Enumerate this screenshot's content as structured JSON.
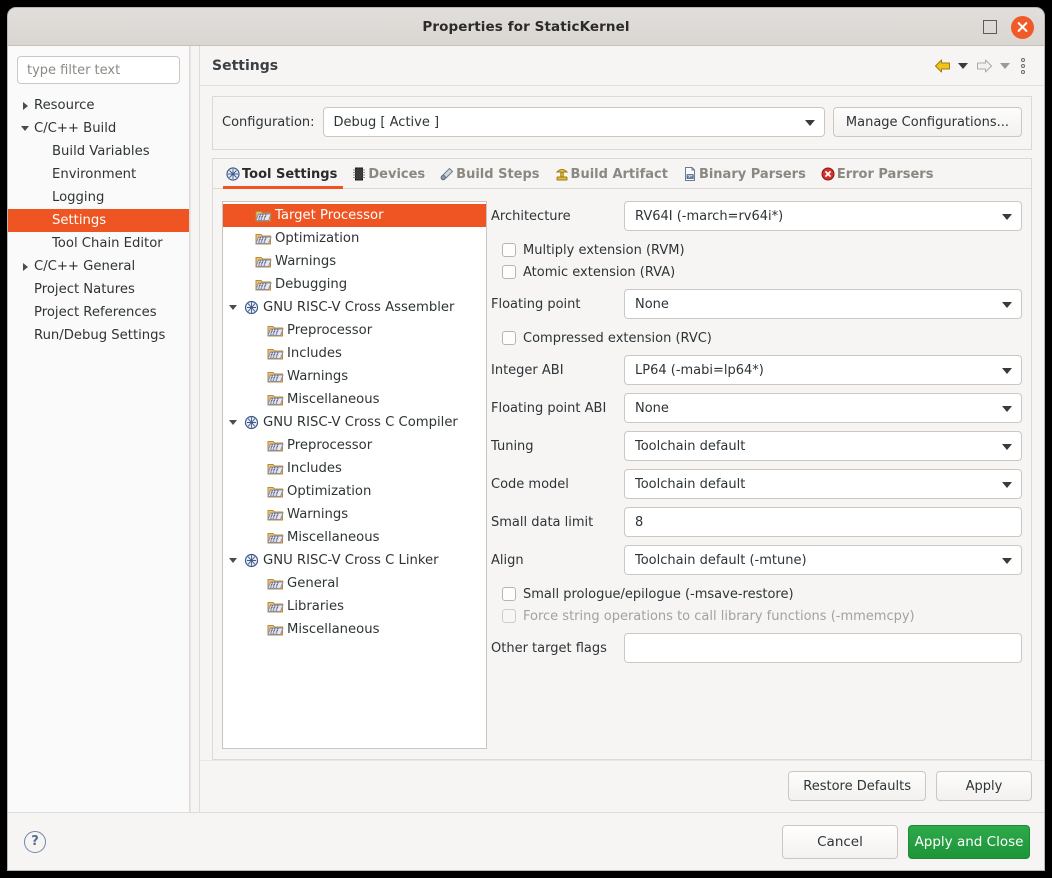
{
  "window": {
    "title": "Properties for StaticKernel",
    "maximize_icon": "maximize-icon",
    "close_icon": "close-icon"
  },
  "sidebar": {
    "filter_placeholder": "type filter text",
    "items": [
      {
        "label": "Resource",
        "indent": 0,
        "arrow": "collapsed",
        "selected": false
      },
      {
        "label": "C/C++ Build",
        "indent": 0,
        "arrow": "expanded",
        "selected": false
      },
      {
        "label": "Build Variables",
        "indent": 1,
        "arrow": "none",
        "selected": false
      },
      {
        "label": "Environment",
        "indent": 1,
        "arrow": "none",
        "selected": false
      },
      {
        "label": "Logging",
        "indent": 1,
        "arrow": "none",
        "selected": false
      },
      {
        "label": "Settings",
        "indent": 1,
        "arrow": "none",
        "selected": true
      },
      {
        "label": "Tool Chain Editor",
        "indent": 1,
        "arrow": "none",
        "selected": false
      },
      {
        "label": "C/C++ General",
        "indent": 0,
        "arrow": "collapsed",
        "selected": false
      },
      {
        "label": "Project Natures",
        "indent": 0,
        "arrow": "none",
        "selected": false
      },
      {
        "label": "Project References",
        "indent": 0,
        "arrow": "none",
        "selected": false
      },
      {
        "label": "Run/Debug Settings",
        "indent": 0,
        "arrow": "none",
        "selected": false
      }
    ]
  },
  "header": {
    "title": "Settings",
    "back_icon": "back-arrow-icon",
    "back_menu_icon": "chevron-down-icon",
    "forward_icon": "forward-arrow-icon",
    "forward_menu_icon": "chevron-down-icon",
    "menu_icon": "kebab-menu-icon"
  },
  "configuration": {
    "label": "Configuration:",
    "value": "Debug  [ Active ]",
    "manage_button": "Manage Configurations..."
  },
  "tabs": [
    {
      "label": "Tool Settings",
      "icon": "tool-settings-icon",
      "active": true
    },
    {
      "label": "Devices",
      "icon": "devices-icon",
      "active": false
    },
    {
      "label": "Build Steps",
      "icon": "build-steps-icon",
      "active": false
    },
    {
      "label": "Build Artifact",
      "icon": "build-artifact-icon",
      "active": false
    },
    {
      "label": "Binary Parsers",
      "icon": "binary-parsers-icon",
      "active": false
    },
    {
      "label": "Error Parsers",
      "icon": "error-parsers-icon",
      "active": false
    }
  ],
  "options_tree": [
    {
      "label": "Target Processor",
      "indent": 1,
      "arrow": "none",
      "icon": "folder-icon",
      "selected": true
    },
    {
      "label": "Optimization",
      "indent": 1,
      "arrow": "none",
      "icon": "folder-icon",
      "selected": false
    },
    {
      "label": "Warnings",
      "indent": 1,
      "arrow": "none",
      "icon": "folder-icon",
      "selected": false
    },
    {
      "label": "Debugging",
      "indent": 1,
      "arrow": "none",
      "icon": "folder-icon",
      "selected": false
    },
    {
      "label": "GNU RISC-V Cross Assembler",
      "indent": 0,
      "arrow": "expanded",
      "icon": "tool-icon",
      "selected": false
    },
    {
      "label": "Preprocessor",
      "indent": 2,
      "arrow": "none",
      "icon": "folder-icon",
      "selected": false
    },
    {
      "label": "Includes",
      "indent": 2,
      "arrow": "none",
      "icon": "folder-icon",
      "selected": false
    },
    {
      "label": "Warnings",
      "indent": 2,
      "arrow": "none",
      "icon": "folder-icon",
      "selected": false
    },
    {
      "label": "Miscellaneous",
      "indent": 2,
      "arrow": "none",
      "icon": "folder-icon",
      "selected": false
    },
    {
      "label": "GNU RISC-V Cross C Compiler",
      "indent": 0,
      "arrow": "expanded",
      "icon": "tool-icon",
      "selected": false
    },
    {
      "label": "Preprocessor",
      "indent": 2,
      "arrow": "none",
      "icon": "folder-icon",
      "selected": false
    },
    {
      "label": "Includes",
      "indent": 2,
      "arrow": "none",
      "icon": "folder-icon",
      "selected": false
    },
    {
      "label": "Optimization",
      "indent": 2,
      "arrow": "none",
      "icon": "folder-icon",
      "selected": false
    },
    {
      "label": "Warnings",
      "indent": 2,
      "arrow": "none",
      "icon": "folder-icon",
      "selected": false
    },
    {
      "label": "Miscellaneous",
      "indent": 2,
      "arrow": "none",
      "icon": "folder-icon",
      "selected": false
    },
    {
      "label": "GNU RISC-V Cross C Linker",
      "indent": 0,
      "arrow": "expanded",
      "icon": "tool-icon",
      "selected": false
    },
    {
      "label": "General",
      "indent": 2,
      "arrow": "none",
      "icon": "folder-icon",
      "selected": false
    },
    {
      "label": "Libraries",
      "indent": 2,
      "arrow": "none",
      "icon": "folder-icon",
      "selected": false
    },
    {
      "label": "Miscellaneous",
      "indent": 2,
      "arrow": "none",
      "icon": "folder-icon",
      "selected": false
    }
  ],
  "form": {
    "architecture": {
      "label": "Architecture",
      "value": "RV64I (-march=rv64i*)",
      "type": "combo"
    },
    "multiply_ext": {
      "label": "Multiply extension (RVM)",
      "checked": false,
      "enabled": true
    },
    "atomic_ext": {
      "label": "Atomic extension (RVA)",
      "checked": false,
      "enabled": true
    },
    "floating_point": {
      "label": "Floating point",
      "value": "None",
      "type": "combo"
    },
    "compressed_ext": {
      "label": "Compressed extension (RVC)",
      "checked": false,
      "enabled": true
    },
    "integer_abi": {
      "label": "Integer ABI",
      "value": "LP64 (-mabi=lp64*)",
      "type": "combo"
    },
    "floating_point_abi": {
      "label": "Floating point ABI",
      "value": "None",
      "type": "combo"
    },
    "tuning": {
      "label": "Tuning",
      "value": "Toolchain default",
      "type": "combo"
    },
    "code_model": {
      "label": "Code model",
      "value": "Toolchain default",
      "type": "combo"
    },
    "small_data_limit": {
      "label": "Small data limit",
      "value": "8",
      "type": "text"
    },
    "align": {
      "label": "Align",
      "value": "Toolchain default (-mtune)",
      "type": "combo"
    },
    "small_prologue": {
      "label": "Small prologue/epilogue (-msave-restore)",
      "checked": false,
      "enabled": true
    },
    "force_string_ops": {
      "label": "Force string operations to call library functions (-mmemcpy)",
      "checked": false,
      "enabled": false
    },
    "other_target_flags": {
      "label": "Other target flags",
      "value": "",
      "type": "text"
    }
  },
  "page_buttons": {
    "restore_defaults": "Restore Defaults",
    "apply": "Apply"
  },
  "footer": {
    "help_icon": "help-icon",
    "help_glyph": "?",
    "cancel": "Cancel",
    "apply_and_close": "Apply and Close"
  },
  "colors": {
    "selection_orange": "#ef5523",
    "accent_underline": "#ef5523",
    "close_button": "#f05a28",
    "apply_close_green": "#1d9438",
    "window_bg": "#f6f5f4",
    "field_bg": "#ffffff"
  }
}
